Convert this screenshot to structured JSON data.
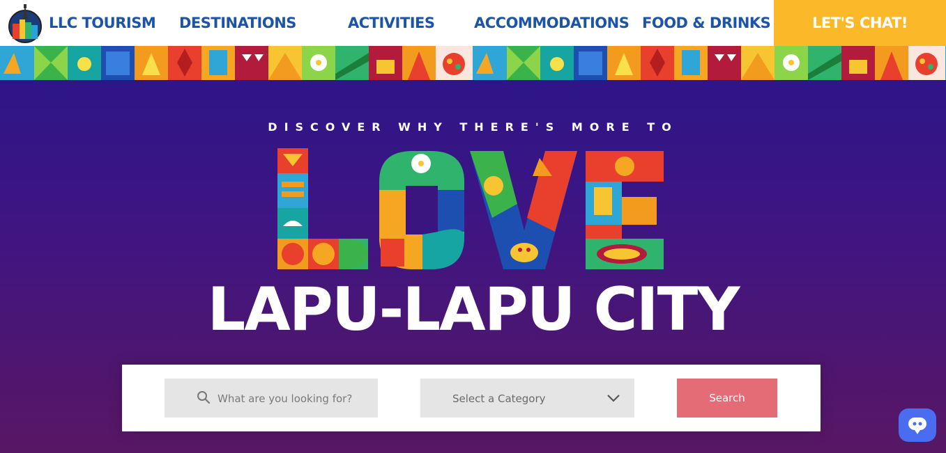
{
  "nav": {
    "brand": "LLC TOURISM",
    "links": [
      "DESTINATIONS",
      "ACTIVITIES",
      "ACCOMMODATIONS",
      "FOOD & DRINKS"
    ],
    "chat_label": "LET'S CHAT!"
  },
  "hero": {
    "tagline": "DISCOVER WHY THERE'S MORE TO",
    "headline_love": "LOVE",
    "city": "LAPU-LAPU CITY"
  },
  "search": {
    "placeholder": "What are you looking for?",
    "category_placeholder": "Select a Category",
    "button_label": "Search"
  },
  "icons": [
    "logo-icon",
    "search-icon",
    "chevron-down-icon",
    "chatbot-icon"
  ],
  "colors": {
    "nav_link": "#1c55a8",
    "chat_button": "#fbb829",
    "search_button": "#e36c76",
    "chatbot": "#4a6cf0",
    "hero_top": "#2e1588",
    "hero_bottom": "#581764"
  }
}
